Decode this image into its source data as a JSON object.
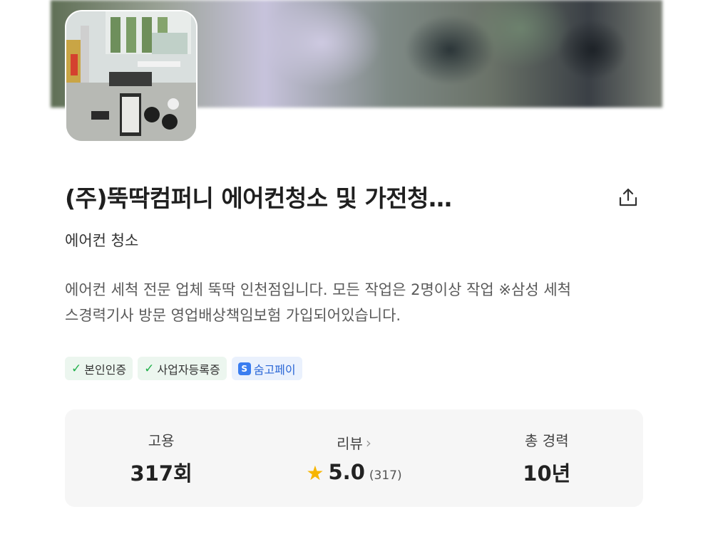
{
  "profile": {
    "title": "(주)뚝딱컴퍼니 에어컨청소 및 가전청…",
    "category": "에어컨 청소",
    "description_lines": [
      "에어컨 세척 전문 업체 뚝딱 인천점입니다. 모든 작업은 2명이상 작업 ※삼성 세척",
      "스경력기사 방문 영업배상책임보험 가입되어있습니다."
    ]
  },
  "badges": [
    {
      "label": "본인인증",
      "icon": "check-icon"
    },
    {
      "label": "사업자등록증",
      "icon": "check-icon"
    },
    {
      "label": "숨고페이",
      "icon": "pay-icon"
    }
  ],
  "stats": {
    "hire": {
      "label": "고용",
      "value": "317회"
    },
    "review": {
      "label": "리뷰",
      "rating": "5.0",
      "count": "(317)"
    },
    "career": {
      "label": "총 경력",
      "value": "10년"
    }
  },
  "colors": {
    "check": "#22b04b",
    "pay": "#2a66d6",
    "star": "#f7b500",
    "stats_bg": "#f6f6f6"
  }
}
